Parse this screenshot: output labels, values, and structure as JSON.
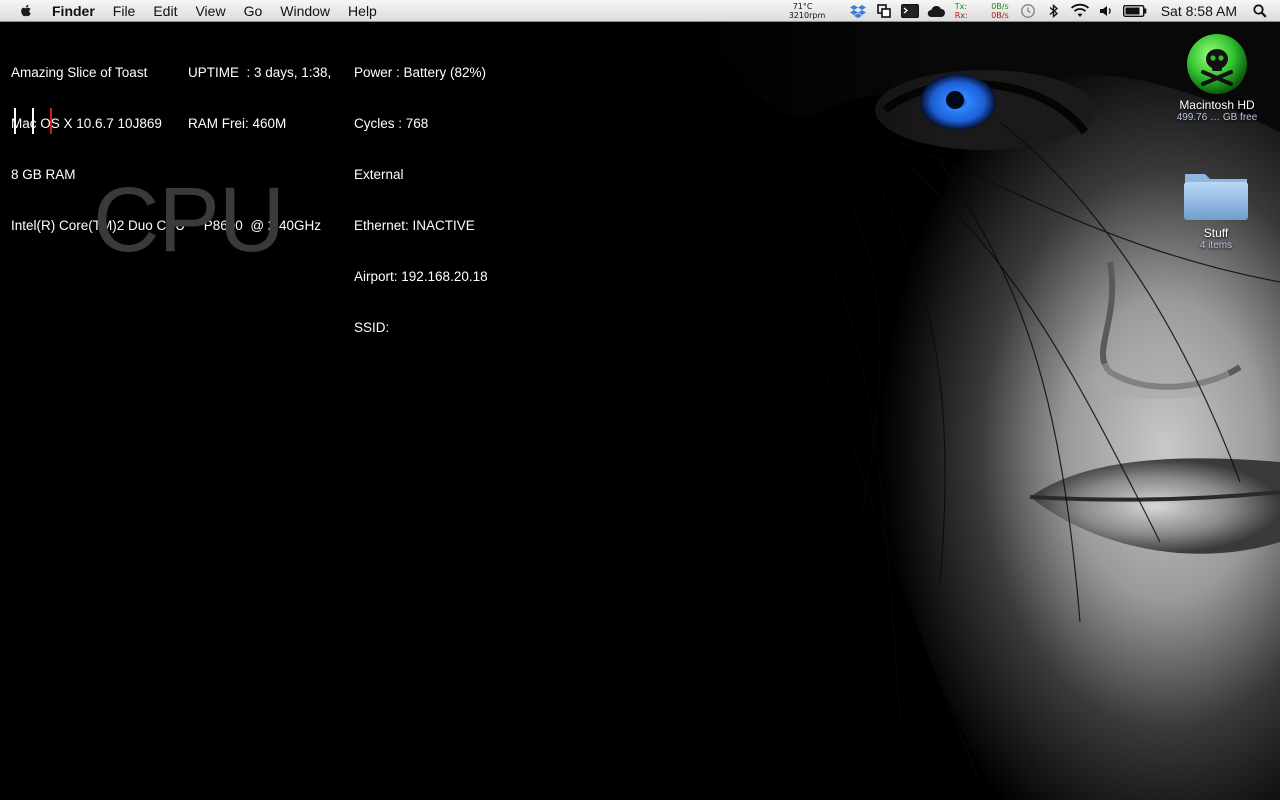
{
  "menubar": {
    "app_name": "Finder",
    "menus": [
      "File",
      "Edit",
      "View",
      "Go",
      "Window",
      "Help"
    ],
    "temperature": "71°C",
    "fan": "3210rpm",
    "net": {
      "tx_label": "Tx:",
      "rx_label": "Rx:",
      "tx_value": "0B/s",
      "rx_value": "0B/s"
    },
    "clock": "Sat 8:58 AM"
  },
  "system_info": {
    "line1": "Amazing Slice of Toast",
    "line2": "Mac OS X 10.6.7 10J869",
    "line3": "8 GB RAM",
    "line4": "Intel(R) Core(TM)2 Duo CPU     P8600  @ 2.40GHz"
  },
  "uptime": {
    "line1": "UPTIME  : 3 days, 1:38,",
    "line2": "RAM Frei: 460M"
  },
  "power_net": {
    "line1": "Power : Battery (82%)",
    "line2": "Cycles : 768",
    "line3": "External",
    "line4": "Ethernet: INACTIVE",
    "line5": "Airport: 192.168.20.18",
    "line6": "SSID:"
  },
  "cpu_label": "CPU",
  "desktop_icons": [
    {
      "name": "Macintosh HD",
      "sub": "499.76 … GB free"
    },
    {
      "name": "Stuff",
      "sub": "4 items"
    }
  ],
  "colors": {
    "menubar": "#e8e8e8",
    "cpu_label": "#3a3a3a",
    "accent_red": "#d61a1a",
    "skull_green": "#3fd23f",
    "eye_blue": "#2f86ff"
  }
}
